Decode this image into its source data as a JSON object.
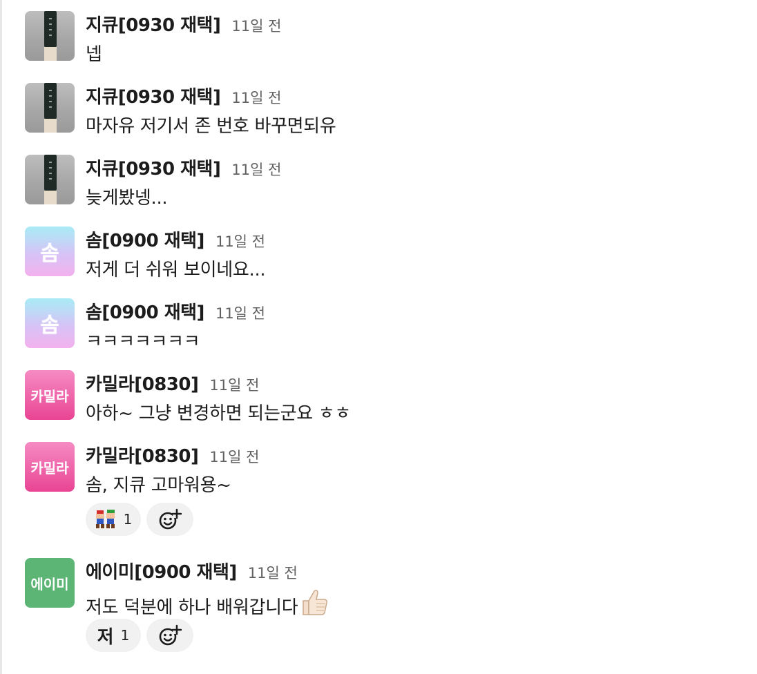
{
  "messages": [
    {
      "author": "지큐[0930 재택]",
      "time": "11일 전",
      "text": "넵",
      "avatar": "photo"
    },
    {
      "author": "지큐[0930 재택]",
      "time": "11일 전",
      "text": "마자유 저기서 존 번호 바꾸면되유",
      "avatar": "photo"
    },
    {
      "author": "지큐[0930 재택]",
      "time": "11일 전",
      "text": "늦게봤넹...",
      "avatar": "photo"
    },
    {
      "author": "솜[0900 재택]",
      "time": "11일 전",
      "text": "저게 더 쉬워 보이네요...",
      "avatar": "솜"
    },
    {
      "author": "솜[0900 재택]",
      "time": "11일 전",
      "text": "ㅋㅋㅋㅋㅋㅋㅋ",
      "avatar": "솜"
    },
    {
      "author": "카밀라[0830]",
      "time": "11일 전",
      "text": "아하~ 그냥 변경하면 되는군요 ㅎㅎ",
      "avatar": "카밀라"
    },
    {
      "author": "카밀라[0830]",
      "time": "11일 전",
      "text": "솜, 지큐 고마워용~",
      "avatar": "카밀라",
      "reaction": {
        "emoji": "mario-brothers-emoji",
        "count": "1"
      }
    },
    {
      "author": "에이미[0900 재택]",
      "time": "11일 전",
      "text": "저도 덕분에 하나 배워갑니다",
      "avatar": "에이미",
      "trailing_emoji": "thumbs-up-emoji",
      "reaction": {
        "emoji_text": "저",
        "count": "1"
      }
    }
  ],
  "icons": {
    "add_reaction": "add-reaction-icon"
  },
  "colors": {
    "camila_avatar": "#e94595",
    "amy_avatar": "#5cb574",
    "som_avatar_top": "#a9ecf6",
    "som_avatar_bottom": "#f3b1ee",
    "reaction_pill": "#f1f1f1",
    "timestamp": "#616061"
  }
}
